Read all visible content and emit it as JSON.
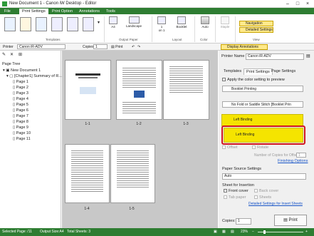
{
  "window": {
    "title": "New Document 1 - Canon iW Desktop - Editor"
  },
  "menu": {
    "tabs": [
      "File",
      "Print Settings",
      "Print Option",
      "Annotations",
      "Tools"
    ],
    "active": "Print Settings"
  },
  "ribbon": {
    "templates_label": "Templates",
    "output_paper": {
      "size": "A4",
      "orientation": "Landscape",
      "group_label": "Output Paper"
    },
    "layout": {
      "n_up": "1",
      "n_up_sub": "on 1",
      "booklet": "Booklet",
      "group_label": "Layout"
    },
    "color": {
      "label": "Auto",
      "group_label": "Color"
    },
    "staple": {
      "label": "Staple"
    },
    "view": {
      "navigation": "Navigation",
      "detailed_settings": "Detailed Settings",
      "group_label": "View"
    }
  },
  "toolbar": {
    "printer_label": "Printer",
    "printer_value": "Canon iR-ADV",
    "copies_label": "Copies",
    "copies_value": "1",
    "print_label": "Print",
    "display_annotations": "Display Annotations"
  },
  "tree": {
    "header": "Page Tree",
    "root": "New Document 1",
    "chapter": "[Chapter1] Summary of R...",
    "pages": [
      "Page 1",
      "Page 2",
      "Page 3",
      "Page 4",
      "Page 5",
      "Page 6",
      "Page 7",
      "Page 8",
      "Page 9",
      "Page 10",
      "Page 11"
    ]
  },
  "preview": {
    "labels": [
      "1-1",
      "1-2",
      "1-3",
      "1-4",
      "1-5"
    ]
  },
  "right_panel": {
    "printer_name_label": "Printer Name",
    "printer_name_value": "Canon iR-ADV",
    "tabs": [
      "Templates",
      "Print Settings",
      "Page Settings"
    ],
    "apply_color": "Apply the color setting to preview",
    "booklet_printing": "Booklet Printing",
    "fold_option": "No Fold or Saddle Stitch [Booklet Prin",
    "left_binding_1": "Left Binding",
    "left_binding_2": "Left Binding",
    "offset": "Offset",
    "rotate": "Rotate",
    "copies_for_offset_label": "Number of Copies for Offset",
    "copies_for_offset_value": "1",
    "finishing_options": "Finishing Options",
    "paper_source_label": "Paper Source Settings",
    "paper_source_value": "Auto",
    "sheet_insertion_label": "Sheet for Insertion",
    "front_cover": "Front cover",
    "back_cover": "Back cover",
    "tab_paper": "Tab paper",
    "sheets": "Sheets",
    "detailed_insert": "Detailed Settings for Insert Sheets",
    "copies_label": "Copies:",
    "copies_value": "1",
    "print_button": "Print"
  },
  "status": {
    "selected": "Selected Page: /11",
    "output_size": "Output Size:A4",
    "total_sheets": "Total Sheets: 3",
    "zoom": "23%"
  },
  "colors": {
    "accent": "#2e7d32",
    "highlight": "#f5e400",
    "annotation": "#d0141e"
  }
}
